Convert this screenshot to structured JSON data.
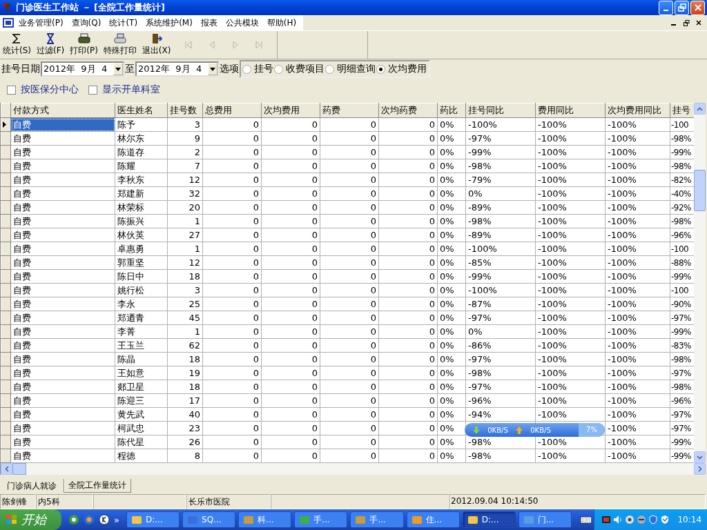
{
  "window": {
    "title": "门诊医生工作站 － [全院工作量统计]"
  },
  "menu": [
    "业务管理(P)",
    "查询(Q)",
    "统计(T)",
    "系统维护(M)",
    "报表",
    "公共模块",
    "帮助(H)"
  ],
  "toolbar": [
    {
      "kind": "sum",
      "label": "统计(S)"
    },
    {
      "kind": "filter",
      "label": "过滤(F)"
    },
    {
      "kind": "print",
      "label": "打印(P)"
    },
    {
      "kind": "special_print",
      "label": "特殊打印"
    },
    {
      "kind": "exit",
      "label": "退出(X)"
    }
  ],
  "nav_buttons": [
    {
      "kind": "first",
      "disabled": true
    },
    {
      "kind": "prev",
      "disabled": true
    },
    {
      "kind": "next",
      "disabled": true
    },
    {
      "kind": "last",
      "disabled": true
    }
  ],
  "filter": {
    "date_label": "挂号日期",
    "date_from": "2012年  9月  4",
    "to_label": "至",
    "date_to": "2012年  9月  4",
    "options_label": "选项",
    "options": [
      {
        "label": "挂号",
        "selected": false
      },
      {
        "label": "收费项目",
        "selected": false
      },
      {
        "label": "明细查询",
        "selected": false
      },
      {
        "label": "次均费用",
        "selected": true
      }
    ],
    "checkboxes": [
      {
        "label": "按医保分中心",
        "checked": false
      },
      {
        "label": "显示开单科室",
        "checked": false
      }
    ]
  },
  "table": {
    "columns": [
      "付款方式",
      "医生姓名",
      "挂号数",
      "总费用",
      "次均费用",
      "药费",
      "次均药费",
      "药比",
      "挂号同比",
      "费用同比",
      "次均费用同比",
      "挂号"
    ],
    "rows": [
      {
        "selected": true,
        "cells": [
          "自费",
          "陈予",
          "3",
          "0",
          "0",
          "0",
          "0",
          "0%",
          "-100%",
          "-100%",
          "-100%",
          "-100"
        ]
      },
      {
        "selected": false,
        "cells": [
          "自费",
          "林尔东",
          "9",
          "0",
          "0",
          "0",
          "0",
          "0%",
          "-97%",
          "-100%",
          "-100%",
          "-98%"
        ]
      },
      {
        "selected": false,
        "cells": [
          "自费",
          "陈道存",
          "2",
          "0",
          "0",
          "0",
          "0",
          "0%",
          "-99%",
          "-100%",
          "-100%",
          "-99%"
        ]
      },
      {
        "selected": false,
        "cells": [
          "自费",
          "陈耀",
          "7",
          "0",
          "0",
          "0",
          "0",
          "0%",
          "-98%",
          "-100%",
          "-100%",
          "-98%"
        ]
      },
      {
        "selected": false,
        "cells": [
          "自费",
          "李秋东",
          "12",
          "0",
          "0",
          "0",
          "0",
          "0%",
          "-79%",
          "-100%",
          "-100%",
          "-82%"
        ]
      },
      {
        "selected": false,
        "cells": [
          "自费",
          "郑建新",
          "32",
          "0",
          "0",
          "0",
          "0",
          "0%",
          "0%",
          "-100%",
          "-100%",
          "-40%"
        ]
      },
      {
        "selected": false,
        "cells": [
          "自费",
          "林荣标",
          "20",
          "0",
          "0",
          "0",
          "0",
          "0%",
          "-89%",
          "-100%",
          "-100%",
          "-92%"
        ]
      },
      {
        "selected": false,
        "cells": [
          "自费",
          "陈振兴",
          "1",
          "0",
          "0",
          "0",
          "0",
          "0%",
          "-98%",
          "-100%",
          "-100%",
          "-98%"
        ]
      },
      {
        "selected": false,
        "cells": [
          "自费",
          "林伙英",
          "27",
          "0",
          "0",
          "0",
          "0",
          "0%",
          "-89%",
          "-100%",
          "-100%",
          "-96%"
        ]
      },
      {
        "selected": false,
        "cells": [
          "自费",
          "卓惠勇",
          "1",
          "0",
          "0",
          "0",
          "0",
          "0%",
          "-100%",
          "-100%",
          "-100%",
          "-100"
        ]
      },
      {
        "selected": false,
        "cells": [
          "自费",
          "郭重坚",
          "12",
          "0",
          "0",
          "0",
          "0",
          "0%",
          "-85%",
          "-100%",
          "-100%",
          "-88%"
        ]
      },
      {
        "selected": false,
        "cells": [
          "自费",
          "陈日中",
          "18",
          "0",
          "0",
          "0",
          "0",
          "0%",
          "-99%",
          "-100%",
          "-100%",
          "-99%"
        ]
      },
      {
        "selected": false,
        "cells": [
          "自费",
          "姚行松",
          "3",
          "0",
          "0",
          "0",
          "0",
          "0%",
          "-100%",
          "-100%",
          "-100%",
          "-100"
        ]
      },
      {
        "selected": false,
        "cells": [
          "自费",
          "李永",
          "25",
          "0",
          "0",
          "0",
          "0",
          "0%",
          "-87%",
          "-100%",
          "-100%",
          "-90%"
        ]
      },
      {
        "selected": false,
        "cells": [
          "自费",
          "郑迺青",
          "45",
          "0",
          "0",
          "0",
          "0",
          "0%",
          "-97%",
          "-100%",
          "-100%",
          "-97%"
        ]
      },
      {
        "selected": false,
        "cells": [
          "自费",
          "李菁",
          "1",
          "0",
          "0",
          "0",
          "0",
          "0%",
          "0%",
          "-100%",
          "-100%",
          "-99%"
        ]
      },
      {
        "selected": false,
        "cells": [
          "自费",
          "王玉兰",
          "62",
          "0",
          "0",
          "0",
          "0",
          "0%",
          "-86%",
          "-100%",
          "-100%",
          "-83%"
        ]
      },
      {
        "selected": false,
        "cells": [
          "自费",
          "陈晶",
          "18",
          "0",
          "0",
          "0",
          "0",
          "0%",
          "-97%",
          "-100%",
          "-100%",
          "-98%"
        ]
      },
      {
        "selected": false,
        "cells": [
          "自费",
          "王如意",
          "19",
          "0",
          "0",
          "0",
          "0",
          "0%",
          "-98%",
          "-100%",
          "-100%",
          "-97%"
        ]
      },
      {
        "selected": false,
        "cells": [
          "自费",
          "郯卫星",
          "18",
          "0",
          "0",
          "0",
          "0",
          "0%",
          "-97%",
          "-100%",
          "-100%",
          "-98%"
        ]
      },
      {
        "selected": false,
        "cells": [
          "自费",
          "陈迎三",
          "17",
          "0",
          "0",
          "0",
          "0",
          "0%",
          "-96%",
          "-100%",
          "-100%",
          "-96%"
        ]
      },
      {
        "selected": false,
        "cells": [
          "自费",
          "黄先武",
          "40",
          "0",
          "0",
          "0",
          "0",
          "0%",
          "-94%",
          "-100%",
          "-100%",
          "-97%"
        ]
      },
      {
        "selected": false,
        "cells": [
          "自费",
          "柯武忠",
          "23",
          "0",
          "0",
          "0",
          "0",
          "0%",
          null,
          null,
          "-100%",
          "-97%"
        ]
      },
      {
        "selected": false,
        "cells": [
          "自费",
          "陈代星",
          "26",
          "0",
          "0",
          "0",
          "0",
          "0%",
          "-98%",
          "-100%",
          "-100%",
          "-99%"
        ]
      },
      {
        "selected": false,
        "cells": [
          "自费",
          "程德",
          "8",
          "0",
          "0",
          "0",
          "0",
          "0%",
          "-98%",
          "-100%",
          "-100%",
          "-99%"
        ]
      }
    ]
  },
  "net_monitor": {
    "download": "0KB/S",
    "upload": "0KB/S",
    "usage": "7%"
  },
  "tabs": [
    {
      "label": "门诊病人就诊",
      "selected": false
    },
    {
      "label": "全院工作量统计",
      "selected": true
    }
  ],
  "status_bar": [
    "陈剑锋",
    "内5科",
    "长乐市医院",
    "2012.09.04 10:14:50"
  ],
  "taskbar": {
    "start": "开始",
    "quick_launch_more": "»",
    "tasks": [
      {
        "kind": "folder",
        "label": "D:...",
        "selected": false
      },
      {
        "kind": "sql",
        "label": "SQ...",
        "selected": false
      },
      {
        "kind": "app",
        "label": "科...",
        "selected": false
      },
      {
        "kind": "green",
        "label": "手...",
        "selected": false
      },
      {
        "kind": "app",
        "label": "手...",
        "selected": false
      },
      {
        "kind": "orange",
        "label": "住...",
        "selected": false
      },
      {
        "kind": "folder",
        "label": "D:...",
        "selected": true
      },
      {
        "kind": "doc",
        "label": "门...",
        "selected": false
      }
    ],
    "clock": "10:14"
  }
}
